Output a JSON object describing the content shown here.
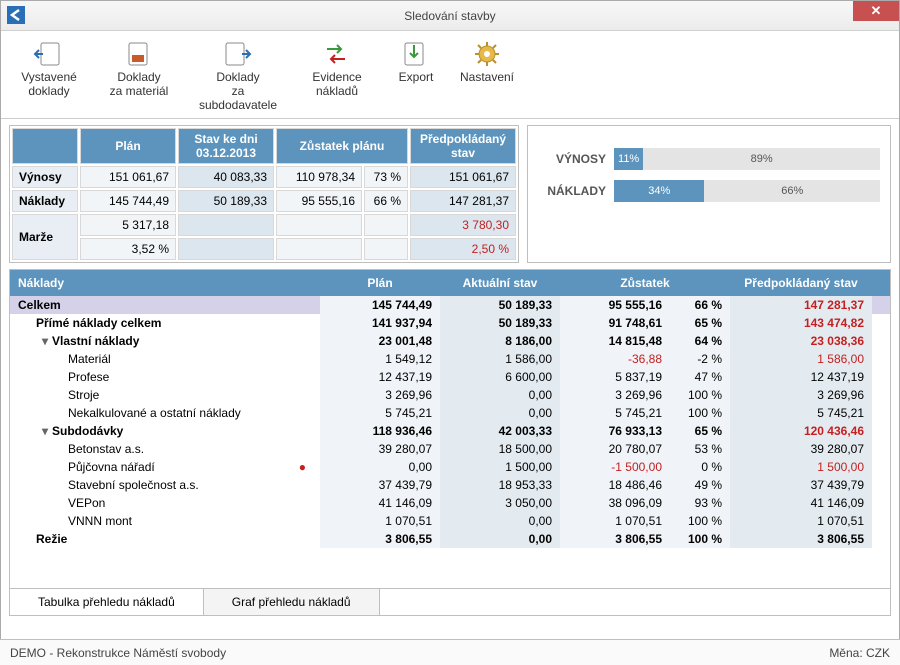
{
  "window": {
    "title": "Sledování stavby"
  },
  "toolbar": {
    "items": [
      {
        "label": "Vystavené\ndoklady"
      },
      {
        "label": "Doklady\nza materiál"
      },
      {
        "label": "Doklady\nza subdodavatele"
      },
      {
        "label": "Evidence\nnákladů"
      },
      {
        "label": "Export"
      },
      {
        "label": "Nastavení"
      }
    ]
  },
  "summary": {
    "headers": [
      "Plán",
      "Stav ke dni 03.12.2013",
      "Zůstatek plánu",
      "",
      "Předpokládaný stav"
    ],
    "rows": [
      {
        "label": "Výnosy",
        "plan": "151 061,67",
        "stav": "40 083,33",
        "zust": "110 978,34",
        "pct": "73 %",
        "predp": "151 061,67"
      },
      {
        "label": "Náklady",
        "plan": "145 744,49",
        "stav": "50 189,33",
        "zust": "95 555,16",
        "pct": "66 %",
        "predp": "147 281,37"
      }
    ],
    "margin": {
      "label": "Marže",
      "abs": "5 317,18",
      "pct": "3,52 %",
      "predp_abs": "3 780,30",
      "predp_pct": "2,50 %"
    }
  },
  "bars": {
    "rows": [
      {
        "label": "VÝNOSY",
        "filled": "11%",
        "rest": "89%",
        "w": 11
      },
      {
        "label": "NÁKLADY",
        "filled": "34%",
        "rest": "66%",
        "w": 34
      }
    ]
  },
  "main": {
    "headers": {
      "name": "Náklady",
      "plan": "Plán",
      "act": "Aktuální stav",
      "zust": "Zůstatek",
      "predp": "Předpokládaný stav"
    },
    "total": {
      "name": "Celkem",
      "plan": "145 744,49",
      "act": "50 189,33",
      "zust": "95 555,16",
      "pct": "66 %",
      "predp": "147 281,37"
    },
    "rows": [
      {
        "lvl": 0,
        "caret": "",
        "name": "Přímé náklady celkem",
        "plan": "141 937,94",
        "act": "50 189,33",
        "zust": "91 748,61",
        "pct": "65 %",
        "predp": "143 474,82",
        "bold": true,
        "predp_red": true
      },
      {
        "lvl": 1,
        "caret": "▾",
        "name": "Vlastní náklady",
        "plan": "23 001,48",
        "act": "8 186,00",
        "zust": "14 815,48",
        "pct": "64 %",
        "predp": "23 038,36",
        "bold": true,
        "predp_red": true
      },
      {
        "lvl": 2,
        "caret": "",
        "name": "Materiál",
        "plan": "1 549,12",
        "act": "1 586,00",
        "zust": "-36,88",
        "zust_red": true,
        "pct": "-2 %",
        "predp": "1 586,00",
        "predp_red": true
      },
      {
        "lvl": 2,
        "caret": "",
        "name": "Profese",
        "plan": "12 437,19",
        "act": "6 600,00",
        "zust": "5 837,19",
        "pct": "47 %",
        "predp": "12 437,19"
      },
      {
        "lvl": 2,
        "caret": "",
        "name": "Stroje",
        "plan": "3 269,96",
        "act": "0,00",
        "zust": "3 269,96",
        "pct": "100 %",
        "predp": "3 269,96"
      },
      {
        "lvl": 2,
        "caret": "",
        "name": "Nekalkulované a ostatní náklady",
        "plan": "5 745,21",
        "act": "0,00",
        "zust": "5 745,21",
        "pct": "100 %",
        "predp": "5 745,21"
      },
      {
        "lvl": 1,
        "caret": "▾",
        "name": "Subdodávky",
        "plan": "118 936,46",
        "act": "42 003,33",
        "zust": "76 933,13",
        "pct": "65 %",
        "predp": "120 436,46",
        "bold": true,
        "predp_red": true
      },
      {
        "lvl": 2,
        "caret": "",
        "name": "Betonstav a.s.",
        "plan": "39 280,07",
        "act": "18 500,00",
        "zust": "20 780,07",
        "pct": "53 %",
        "predp": "39 280,07"
      },
      {
        "lvl": 2,
        "caret": "",
        "name": "Půjčovna nářadí",
        "warn": true,
        "plan": "0,00",
        "act": "1 500,00",
        "zust": "-1 500,00",
        "zust_red": true,
        "pct": "0 %",
        "predp": "1 500,00",
        "predp_red": true
      },
      {
        "lvl": 2,
        "caret": "",
        "name": "Stavební společnost a.s.",
        "plan": "37 439,79",
        "act": "18 953,33",
        "zust": "18 486,46",
        "pct": "49 %",
        "predp": "37 439,79"
      },
      {
        "lvl": 2,
        "caret": "",
        "name": "VEPon",
        "plan": "41 146,09",
        "act": "3 050,00",
        "zust": "38 096,09",
        "pct": "93 %",
        "predp": "41 146,09"
      },
      {
        "lvl": 2,
        "caret": "",
        "name": "VNNN mont",
        "plan": "1 070,51",
        "act": "0,00",
        "zust": "1 070,51",
        "pct": "100 %",
        "predp": "1 070,51"
      },
      {
        "lvl": 0,
        "caret": "",
        "name": "Režie",
        "plan": "3 806,55",
        "act": "0,00",
        "zust": "3 806,55",
        "pct": "100 %",
        "predp": "3 806,55",
        "bold": true
      }
    ]
  },
  "tabs": {
    "table": "Tabulka přehledu nákladů",
    "chart": "Graf přehledu nákladů"
  },
  "status": {
    "left": "DEMO - Rekonstrukce Náměstí svobody",
    "right": "Měna: CZK"
  },
  "chart_data": {
    "type": "bar",
    "categories": [
      "Výnosy",
      "Náklady"
    ],
    "series": [
      {
        "name": "Aktuální stav (%)",
        "values": [
          11,
          34
        ]
      },
      {
        "name": "Zůstatek (%)",
        "values": [
          89,
          66
        ]
      }
    ],
    "title": "",
    "xlabel": "",
    "ylabel": "%",
    "ylim": [
      0,
      100
    ]
  }
}
